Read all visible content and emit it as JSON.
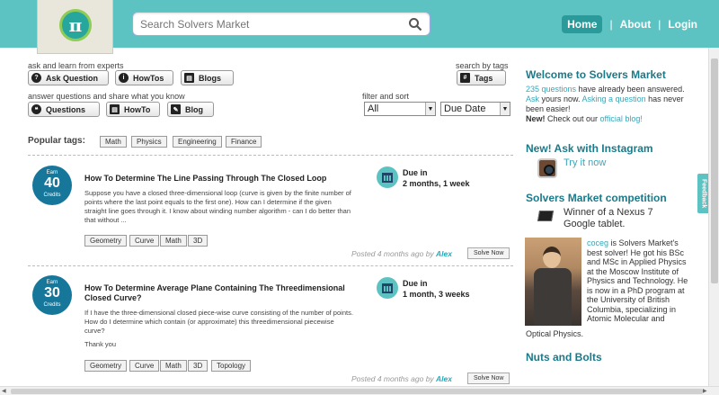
{
  "header": {
    "logo_glyph": "π",
    "search_placeholder": "Search Solvers Market",
    "nav": {
      "home": "Home",
      "about": "About",
      "login": "Login",
      "sep": "|"
    },
    "colors": {
      "bar": "#5cc3c2",
      "accent": "#16779a"
    }
  },
  "actions": {
    "ask_label": "ask and learn from experts",
    "ask_question": "Ask Question",
    "howtos": "HowTos",
    "blogs": "Blogs",
    "answer_label": "answer questions and share what you know",
    "questions": "Questions",
    "howto": "HowTo",
    "blog": "Blog",
    "search_tags_label": "search by tags",
    "tags": "Tags",
    "filter_label": "filter and sort",
    "filter_value": "All",
    "sort_value": "Due Date"
  },
  "popular": {
    "title": "Popular tags:",
    "tags": [
      "Math",
      "Physics",
      "Engineering",
      "Finance"
    ]
  },
  "questions": [
    {
      "earn": "Earn",
      "credits": "40",
      "credits_label": "Credits",
      "title": "How To Determine The Line Passing Through The Closed Loop",
      "body": "Suppose you have a closed three-dimensional loop (curve is given by the finite number of points where the last point equals to the first one). How can I determine if the given straight line goes through it. I know about winding number algorithm - can I do better than that without ...",
      "due_label": "Due in",
      "due_value": "2 months, 1 week",
      "tags": [
        "Geometry",
        "Curve",
        "Math",
        "3D"
      ],
      "posted": "Posted 4 months ago by",
      "author": "Alex",
      "solve": "Solve Now"
    },
    {
      "earn": "Earn",
      "credits": "30",
      "credits_label": "Credits",
      "title": "How To Determine Average Plane Containing The Threedimensional Closed Curve?",
      "body": "If I have the three-dimensional closed piece-wise curve consisting of the number of points. How do I determine which contain (or approximate) this threedimensional piecewise curve?",
      "body2": "Thank you",
      "due_label": "Due in",
      "due_value": "1 month, 3 weeks",
      "tags": [
        "Geometry",
        "Curve",
        "Math",
        "3D",
        "Topology"
      ],
      "posted": "Posted 4 months ago by",
      "author": "Alex",
      "solve": "Solve Now"
    }
  ],
  "sidebar": {
    "welcome_title": "Welcome to Solvers Market",
    "count_link": "235 questions",
    "count_text": " have already been answered.",
    "ask_link": "Ask",
    "ask_text1": " yours now. ",
    "ask_link2": "Asking a question",
    "ask_text2": " has never been easier!",
    "new_bold": "New!",
    "new_text": " Check out our ",
    "blog_link": "official blog!",
    "insta_title": "New! Ask with Instagram",
    "try_it": "Try it now",
    "competition_title": "Solvers Market competition",
    "winner": "Winner of a Nexus 7 Google tablet.",
    "champ_link": "coceg",
    "champ_text": " is Solvers Market's best solver! He got his BSc and MSc in Applied Physics at the Moscow Institute of Physics and Technology. He is now in a PhD program at the University of British Columbia, specializing in Atomic Molecular and",
    "champ_tail": "Optical Physics.",
    "nuts_title": "Nuts and Bolts",
    "feedback": "Feedback"
  }
}
